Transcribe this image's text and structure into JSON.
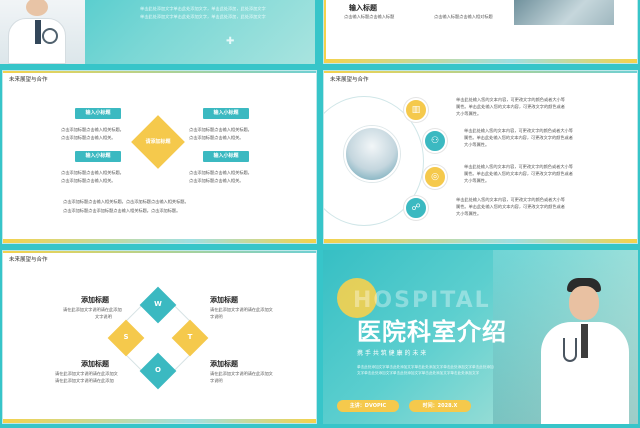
{
  "slide_top_left": {
    "body_lines": [
      "单击此处添加文字单击此处添加文字，单击此处添加，此处添加文字",
      "单击此处添加文字单击此处添加文字，单击此处添加，此处添加文字"
    ]
  },
  "slide_top_right": {
    "heading": "输入标题",
    "left_text": "点击输入标题点击输入标题",
    "right_text": "点击输入标题点击输入相对标题"
  },
  "slide_mid_left": {
    "title": "未来展望与合作",
    "center_label": "请添加标题",
    "labels": [
      "输入小标题",
      "输入小标题",
      "输入小标题",
      "输入小标题"
    ],
    "desc_lines": [
      "点击添加标题点击输入相关标题。",
      "点击添加标题点击输入相关。"
    ],
    "bottom_lines": [
      "点击添加标题点击输入相关标题。点击添加标题点击输入相关标题。",
      "点击添加标题点击添加标题点击输入相关标题。点击添加标题。"
    ]
  },
  "slide_mid_right": {
    "title": "未来展望与合作",
    "items": [
      [
        "单击此处输入您的文本内容，可更改文字的颜色或者大小等",
        "属性。单击此处输入您的文本内容，可更改文字的颜色或者",
        "大小等属性。"
      ],
      [
        "单击此处输入您的文本内容，可更改文字的颜色或者大小等",
        "属性。单击此处输入您的文本内容，可更改文字的颜色或者",
        "大小等属性。"
      ],
      [
        "单击此处输入您的文本内容，可更改文字的颜色或者大小等",
        "属性。单击此处输入您的文本内容，可更改文字的颜色或者",
        "大小等属性。"
      ],
      [
        "单击此处输入您的文本内容，可更改文字的颜色或者大小等",
        "属性。单击此处输入您的文本内容，可更改文字的颜色或者",
        "大小等属性。"
      ]
    ]
  },
  "slide_bottom_left": {
    "title": "未来展望与合作",
    "letters": [
      "W",
      "S",
      "T",
      "O"
    ],
    "blocks": [
      {
        "heading": "添加标题",
        "lines": [
          "请在此添加文字说明请在此添加",
          "文字说明"
        ]
      },
      {
        "heading": "添加标题",
        "lines": [
          "请在此添加文字说明请在此添加文",
          "字说明"
        ]
      },
      {
        "heading": "添加标题",
        "lines": [
          "请在此添加文字说明请在此添加文",
          "请在此添加文字说明请在此添加"
        ]
      },
      {
        "heading": "添加标题",
        "lines": [
          "请在此添加文字说明请在此添加文",
          "字说明"
        ]
      }
    ]
  },
  "slide_cover": {
    "bg_word": "HOSPITAL",
    "title": "医院科室介绍",
    "subtitle": "携 手 共 筑 健 康 的 未 来",
    "small_lines": [
      "单击此处添加文字单击此处添加文字单击此处添加文字单击此处添加文字单击此处添加",
      "文字单击此处添加文字单击此处添加文字单击此处添加文字单击此处添加文字"
    ],
    "speaker_label": "主讲：DVOPIC",
    "date_label": "时间：2028.X"
  }
}
